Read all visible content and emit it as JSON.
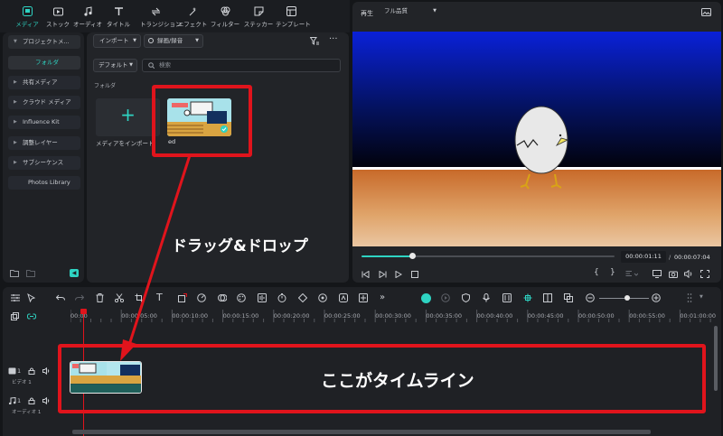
{
  "toolbar": {
    "items": [
      {
        "label": "メディア",
        "icon": "media-icon",
        "active": true
      },
      {
        "label": "ストック",
        "icon": "stock-icon"
      },
      {
        "label": "オーディオ",
        "icon": "audio-icon"
      },
      {
        "label": "タイトル",
        "icon": "title-icon"
      },
      {
        "label": "トランジション",
        "icon": "transition-icon"
      },
      {
        "label": "エフェクト",
        "icon": "effect-icon"
      },
      {
        "label": "フィルター",
        "icon": "filter-icon"
      },
      {
        "label": "ステッカー",
        "icon": "sticker-icon"
      },
      {
        "label": "テンプレート",
        "icon": "template-icon"
      }
    ]
  },
  "sidebar": {
    "items": [
      {
        "label": "プロジェクトメ..."
      },
      {
        "label": "フォルダ"
      },
      {
        "label": "共有メディア"
      },
      {
        "label": "クラウド メディア"
      },
      {
        "label": "Influence Kit"
      },
      {
        "label": "調整レイヤー"
      },
      {
        "label": "サブシーケンス"
      },
      {
        "label": "Photos Library"
      }
    ]
  },
  "media": {
    "import_label": "インポート",
    "record_label": "録画/録音",
    "sort_label": "デフォルト",
    "search_placeholder": "検索",
    "folder_label": "フォルダ",
    "import_tile_label": "メディアをインポート",
    "clip_name": "ed"
  },
  "preview": {
    "tab_label": "再生",
    "quality_label": "フル品質",
    "current_time": "00:00:01:11",
    "separator": "/",
    "total_time": "00:00:07:04",
    "progress": 0.2
  },
  "timeline": {
    "ruler": [
      "00:00",
      "00:00:05:00",
      "00:00:10:00",
      "00:00:15:00",
      "00:00:20:00",
      "00:00:25:00",
      "00:00:30:00",
      "00:00:35:00",
      "00:00:40:00",
      "00:00:45:00",
      "00:00:50:00",
      "00:00:55:00",
      "00:01:00:00"
    ],
    "video_track_label": "ビデオ 1",
    "audio_track_label": "オーディオ 1",
    "track_number": "1"
  },
  "annotations": {
    "drag_drop": "ドラッグ&ドロップ",
    "timeline_here": "ここがタイムライン",
    "color": "#e0141c"
  }
}
